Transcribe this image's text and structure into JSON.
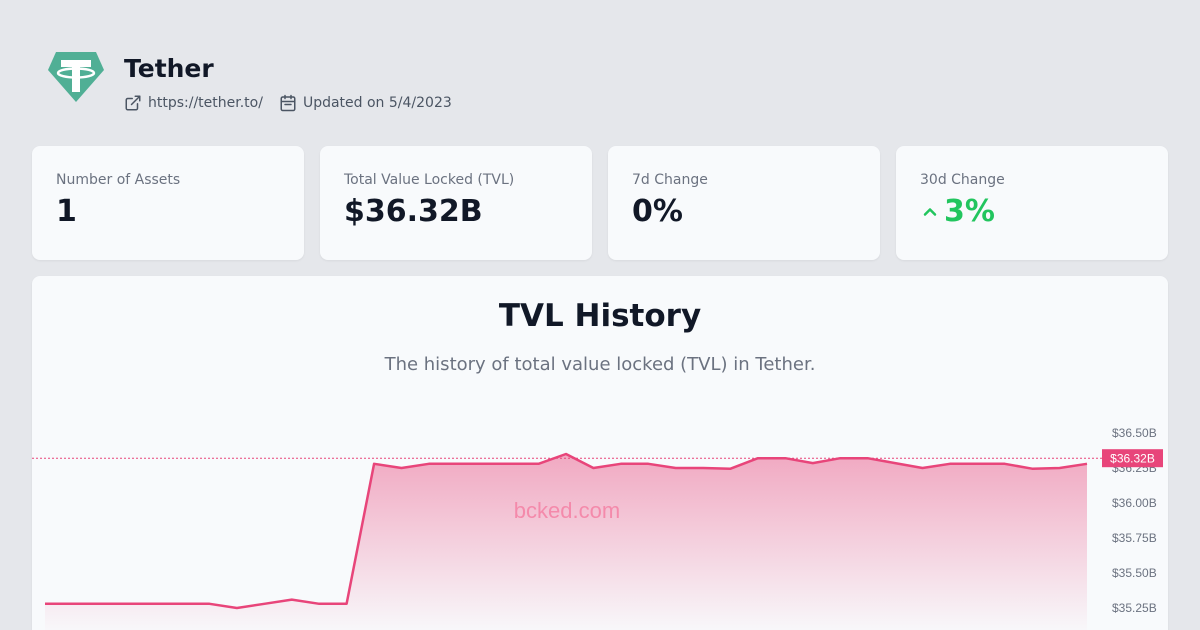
{
  "header": {
    "title": "Tether",
    "link_text": "https://tether.to/",
    "updated_text": "Updated on 5/4/2023",
    "logo_color": "#50af95"
  },
  "stats": [
    {
      "label": "Number of Assets",
      "value": "1"
    },
    {
      "label": "Total Value Locked (TVL)",
      "value": "$36.32B"
    },
    {
      "label": "7d Change",
      "value": "0%"
    },
    {
      "label": "30d Change",
      "value": "3%",
      "trend": "up",
      "trend_color": "#22c55e"
    }
  ],
  "chart_section": {
    "title": "TVL History",
    "subtitle": "The history of total value locked (TVL) in Tether."
  },
  "chart_data": {
    "type": "area",
    "series": [
      {
        "values": [
          35.28,
          35.28,
          35.28,
          35.28,
          35.28,
          35.28,
          35.28,
          35.25,
          35.28,
          35.31,
          35.28,
          35.28,
          36.28,
          36.25,
          36.28,
          36.28,
          36.28,
          36.28,
          36.28,
          36.35,
          36.25,
          36.28,
          36.28,
          36.25,
          36.25,
          36.245,
          36.32,
          36.32,
          36.285,
          36.32,
          36.32,
          36.285,
          36.25,
          36.28,
          36.28,
          36.28,
          36.245,
          36.25,
          36.28
        ],
        "color": "#e8457a"
      }
    ],
    "y_ticks": [
      "$36.50B",
      "$36.25B",
      "$36.00B",
      "$35.75B",
      "$35.50B",
      "$35.25B"
    ],
    "y_tick_values": [
      36.5,
      36.25,
      36.0,
      35.75,
      35.5,
      35.25
    ],
    "ylim": [
      35.25,
      36.5
    ],
    "current_value": 36.32,
    "current_label": "$36.32B",
    "watermark": "bcked.com",
    "reference_line_color": "#e8457a",
    "grid": false
  }
}
